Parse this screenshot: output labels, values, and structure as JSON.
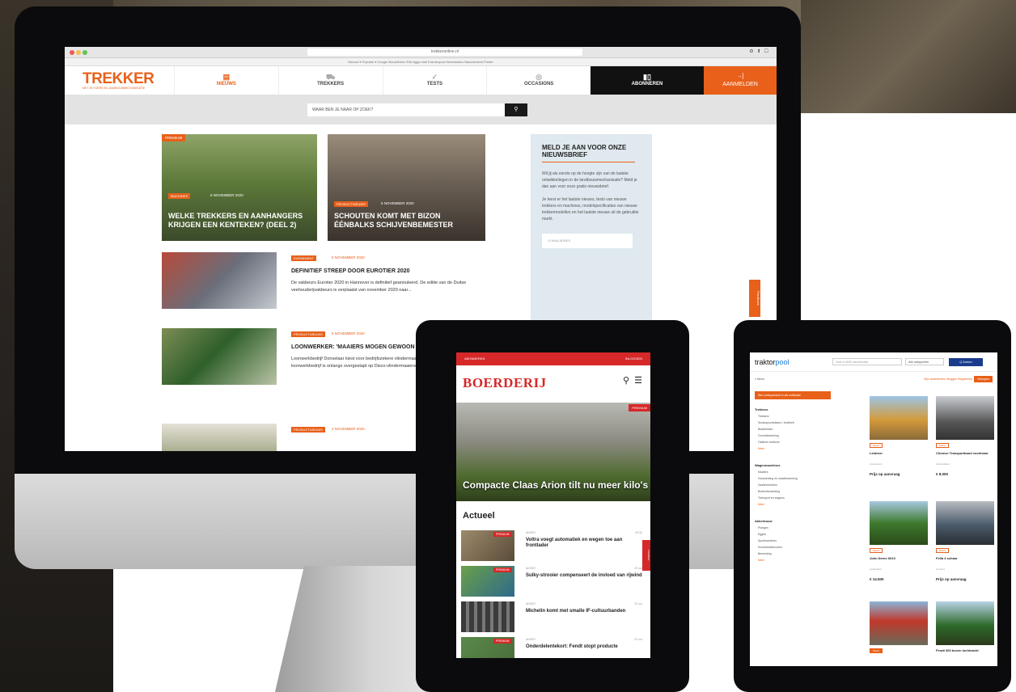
{
  "desktop": {
    "browser": {
      "url": "trekkeronline.nl",
      "bookmarks": "Nieuws ▾   Populair ▾   Google   Bouwfirmen   RAI   Agga mail   Krantenpost   Weerstation   Natuurbeleid   Printer"
    },
    "site": {
      "logo": "TREKKER",
      "logo_tagline": "MET JE KOERS IN LANDBOUWMECHANISATIE",
      "nav": [
        {
          "label": "NIEUWS",
          "icon": "news-icon"
        },
        {
          "label": "TREKKERS",
          "icon": "tractor-icon"
        },
        {
          "label": "TESTS",
          "icon": "checkmark-icon"
        },
        {
          "label": "OCCASIONS",
          "icon": "tag-icon"
        }
      ],
      "subscribe": "ABONNEREN",
      "login": "AANMELDEN",
      "search_placeholder": "WAAR BEN JE NAAR OP ZOEK?"
    },
    "cards": [
      {
        "badge": "MACHINES",
        "date": "5 NOVEMBER 2020",
        "title": "WELKE TREKKERS EN AANHANGERS KRIJGEN EEN KENTEKEN? (DEEL 2)",
        "premium": "PREMIUM"
      },
      {
        "badge": "PRODUCTNIEUWS",
        "date": "5 NOVEMBER 2020",
        "title": "SCHOUTEN KOMT MET BIZON ÉÉNBALKS SCHIJVENBEMESTER"
      }
    ],
    "newsletter": {
      "title": "MELD JE AAN VOOR ONZE NIEUWSBRIEF",
      "p1": "Wil jij als eerste op de hoogte zijn van de laatste ontwikkelingen in de landbouwmechanisatie? Meld je dan aan voor onze gratis nieuwsbrief.",
      "p2": "Je leest er het laatste nieuws, tests van nieuwe trekkers en machines, modelspecificaties van nieuwe trekkermodellen en het laatste nieuws uit de gebruikte markt.",
      "email_placeholder": "E-MAILADRES"
    },
    "articles": [
      {
        "badge": "EVENEMENT",
        "date": "5 NOVEMBER 2020",
        "title": "DEFINITIEF STREEP DOOR EUROTIER 2020",
        "summary": "De vakbeurs Eurotier 2020 in Hannover is definitief geannuleerd. De editie van de Duitse veehouderijvakbeurs is verplaatst van november 2020 naar..."
      },
      {
        "badge": "PRODUCTNIEUWS",
        "date": "5 NOVEMBER 2020",
        "title": "LOONWERKER: 'MAAIERS MOGEN GEWOON STILSTAAN'",
        "summary": "Loonwerkbedrijf Donselaar kiest voor bedrijfszekere vlindermaaiers van Claas. Het loonwerkbedrijf is onlangs overgestapt op Disco-vlindermaaiers..."
      },
      {
        "badge": "PRODUCTNIEUWS",
        "date": "4 NOVEMBER 2020",
        "title": "",
        "summary": ""
      }
    ],
    "feedback": "Feedback"
  },
  "tablet1": {
    "topbar_left": "ABONNEREN",
    "topbar_right": "INLOGGEN",
    "logo": "BOERDERIJ",
    "hero_title": "Compacte Claas Arion tilt nu meer kilo's",
    "hero_badge": "PREMIUM",
    "section": "Actueel",
    "items": [
      {
        "category": "AKKER",
        "time": "09:32",
        "title": "Voltra voegt automatiek en wegen toe aan frontlader",
        "premium": "PREMIUM"
      },
      {
        "category": "AKKER",
        "time": "20 uur",
        "title": "Sulky-strooier compenseert de invloed van rijwind",
        "premium": "PREMIUM"
      },
      {
        "category": "AKKER",
        "time": "20 uur",
        "title": "Michelin komt met smalle IF-cultuurbanden",
        "premium": ""
      },
      {
        "category": "AKKER",
        "time": "23 uur",
        "title": "Onderdelentekort: Fendt stopt producte",
        "premium": "PREMIUM"
      }
    ],
    "side_tab": "Feedback"
  },
  "tablet2": {
    "logo_a": "traktor",
    "logo_b": "pool",
    "search_placeholder": "Zoek in 5000 advertenties",
    "category": "Alle categorieën",
    "search_button": "Q Zoeken",
    "menu": "≡ Menu",
    "links": "Mijn advertenties   Inloggen   Registreren",
    "sell_button": "Verkopen",
    "notify": "Stel zoekopdracht in als notificatie",
    "groups": [
      {
        "name": "Trekkers",
        "items": [
          "Trekkers",
          "Smalspoortrekkers / fruitteelt",
          "Bladtrekken",
          "Grondbewerking",
          "Oldtimer trekkers"
        ]
      },
      {
        "name": "Wagenmachines",
        "items": [
          "Maaiers",
          "Hooiwerking en maaibewerking",
          "Zaaitechnieken",
          "Bodembewerking",
          "Transport en wagens"
        ]
      },
      {
        "name": "Akkerbouw",
        "items": [
          "Ploegen",
          "Eggen",
          "Spuitmachines",
          "Kunstmeststrooiers",
          "Bemesting"
        ]
      }
    ],
    "more": "Meer",
    "cards": [
      {
        "tag": "Nieuw",
        "name": "Liebherr",
        "meta": "Amsterdam",
        "price": "Prijs op aanvraag"
      },
      {
        "tag": "Nieuw",
        "name": "Chinese Transportband vochtvast",
        "meta": "Zuid-Holland",
        "price": "€ 8.000"
      },
      {
        "tag": "Nieuw",
        "name": "John Deere 6610",
        "meta": "Gelderland",
        "price": "€ 14.500"
      },
      {
        "tag": "Nieuw",
        "name": "Fella 4 schaar",
        "meta": "Limburg",
        "price": "Prijs op aanvraag"
      },
      {
        "tag": "Nieuw",
        "name": "",
        "meta": "",
        "price": ""
      },
      {
        "tag": "",
        "name": "Fendt 300 boven luchtvacht",
        "meta": "",
        "price": ""
      }
    ]
  }
}
